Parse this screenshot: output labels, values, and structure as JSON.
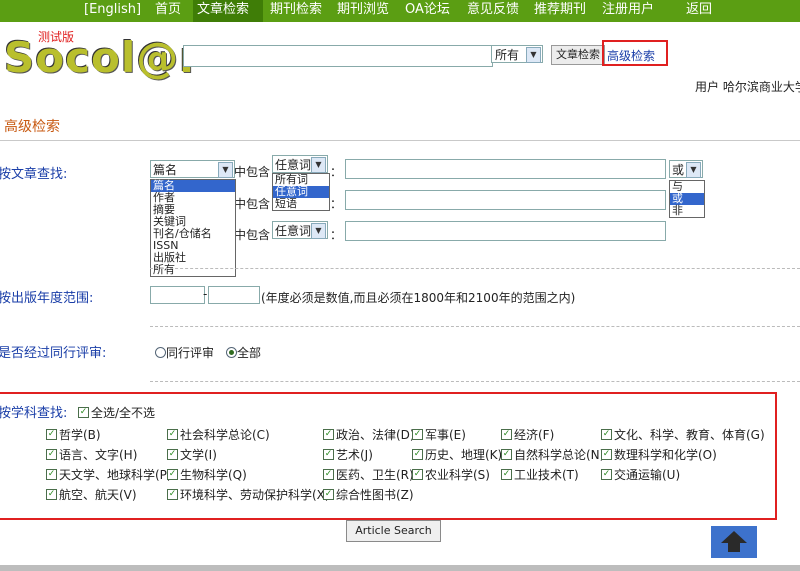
{
  "nav": {
    "items": [
      "[English]",
      "首页",
      "文章检索",
      "期刊检索",
      "期刊浏览",
      "OA论坛",
      "意见反馈",
      "推荐期刊",
      "注册用户",
      "返回"
    ]
  },
  "header": {
    "logo_text": "Socol@r",
    "logo_badge": "测试版",
    "search_value": "",
    "scope_value": "所有",
    "article_search_label": "文章检索",
    "advanced_search_label": "高级检索",
    "user_text": "用户 哈尔滨商业大学"
  },
  "advanced": {
    "title": "高级检索",
    "by_article": {
      "label": "按文章查找:",
      "rows": [
        {
          "field": "篇名",
          "contains": "中包含",
          "mode": "任意词",
          "value": "",
          "bool": "或"
        },
        {
          "field": "",
          "contains": "中包含",
          "mode": "任意词",
          "value": ""
        },
        {
          "field": "",
          "contains": "中包含",
          "mode": "任意词",
          "value": ""
        }
      ],
      "field_options": [
        "篇名",
        "作者",
        "摘要",
        "关键词",
        "刊名/仓储名",
        "ISSN",
        "出版社",
        "所有"
      ],
      "mode_options": [
        "所有词",
        "任意词",
        "短语"
      ],
      "bool_options": [
        "与",
        "或",
        "非"
      ],
      "colon": "："
    },
    "by_year": {
      "label": "按出版年度范围:",
      "from": "",
      "to": "",
      "dash": "-",
      "hint": "(年度必须是数值,而且必须在1800年和2100年的范围之内)"
    },
    "peer_review": {
      "label": "是否经过同行评审:",
      "options": [
        "同行评审",
        "全部"
      ],
      "selected": "全部"
    },
    "by_subject": {
      "label": "按学科查找:",
      "select_all": "全选/全不选",
      "subjects": [
        [
          "哲学(B)",
          "社会科学总论(C)",
          "政治、法律(D)",
          "军事(E)",
          "经济(F)",
          "文化、科学、教育、体育(G)"
        ],
        [
          "语言、文字(H)",
          "文学(I)",
          "艺术(J)",
          "历史、地理(K)",
          "自然科学总论(N)",
          "数理科学和化学(O)"
        ],
        [
          "天文学、地球科学(P)",
          "生物科学(Q)",
          "医药、卫生(R)",
          "农业科学(S)",
          "工业技术(T)",
          "交通运输(U)"
        ],
        [
          "航空、航天(V)",
          "环境科学、劳动保护科学(X)",
          "综合性图书(Z)"
        ]
      ]
    },
    "search_button": "Article Search"
  },
  "colors": {
    "nav_bg": "#5b9e13",
    "accent_red": "#e02020",
    "link_blue": "#1a3ea8",
    "title_orange": "#c85a12"
  },
  "icons": {
    "up": "arrow-up-icon"
  }
}
